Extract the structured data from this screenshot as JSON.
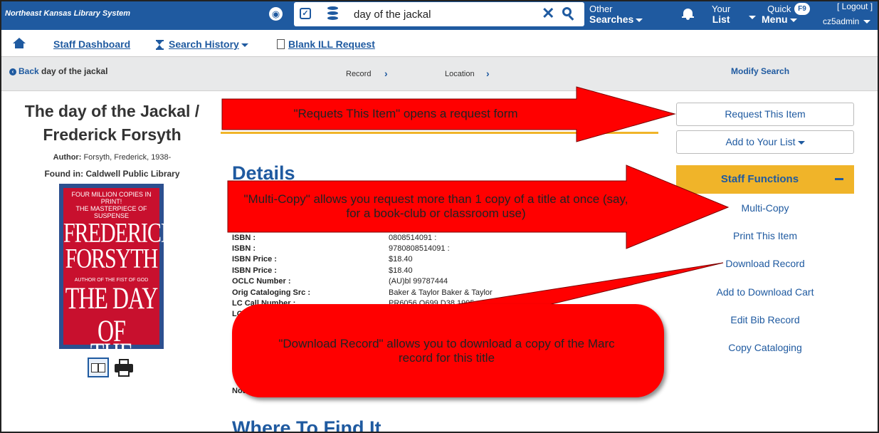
{
  "topbar": {
    "system_name": "Northeast Kansas Library System",
    "search_query": "day of the jackal",
    "other_searches": {
      "line1": "Other",
      "line2": "Searches"
    },
    "your_list": {
      "line1": "Your",
      "line2": "List"
    },
    "quick_menu": {
      "line1": "Quick",
      "line2": "Menu",
      "shortcut": "F9"
    },
    "logout": "[ Logout ]",
    "username": "cz5admin"
  },
  "nav": {
    "staff_dashboard": "Staff Dashboard",
    "search_history": "Search History",
    "blank_ill_request": "Blank ILL Request"
  },
  "breadcrumb": {
    "back_label": "Back",
    "back_query": "day of the jackal",
    "step_record": "Record",
    "step_location": "Location",
    "modify_search": "Modify Search"
  },
  "record": {
    "title_line1": "The day of the Jackal /",
    "title_line2": "Frederick Forsyth",
    "author_label": "Author:",
    "author_value": "Forsyth, Frederick, 1938-",
    "found_in_label": "Found in:",
    "found_in_value": "Caldwell Public Library",
    "cover": {
      "top_line1": "FOUR MILLION COPIES IN PRINT!",
      "top_line2": "THE MASTERPIECE OF SUSPENSE",
      "author_line1": "FREDERICK",
      "author_line2": "FORSYTH",
      "subline": "AUTHOR OF THE FIST OF GOD",
      "title_line1": "THE DAY OF",
      "title_line2": "THE JACKAL"
    }
  },
  "details": {
    "heading": "Details",
    "fields": [
      {
        "label": "ISBN :",
        "value": "0808514091 :"
      },
      {
        "label": "ISBN :",
        "value": "9780808514091 :"
      },
      {
        "label": "ISBN Price :",
        "value": "$18.40"
      },
      {
        "label": "ISBN Price :",
        "value": "$18.40"
      },
      {
        "label": "OCLC Number :",
        "value": "(AU)bl 99787444"
      },
      {
        "label": "Orig Cataloging Src :",
        "value": "Baker & Taylor Baker & Taylor"
      },
      {
        "label": "LC Call Number :",
        "value": "PR6056.O699 D38 1995"
      }
    ],
    "partial_labels": [
      "LC",
      "Notes"
    ],
    "where_heading": "Where To Find It"
  },
  "actions": {
    "request_item": "Request This Item",
    "add_to_list": "Add to Your List"
  },
  "staff_functions": {
    "heading": "Staff Functions",
    "links": [
      "Multi-Copy",
      "Print This Item",
      "Download Record",
      "Add to Download Cart",
      "Edit Bib Record",
      "Copy Cataloging"
    ]
  },
  "annotations": {
    "request": "\"Requets This Item\" opens a request form",
    "multicopy": "\"Multi-Copy\" allows you request more than 1 copy of a title at once (say, for a book-club or classroom use)",
    "download": "\"Download Record\" allows you to download a copy of the Marc record for this title",
    "color": "#ff0000"
  }
}
